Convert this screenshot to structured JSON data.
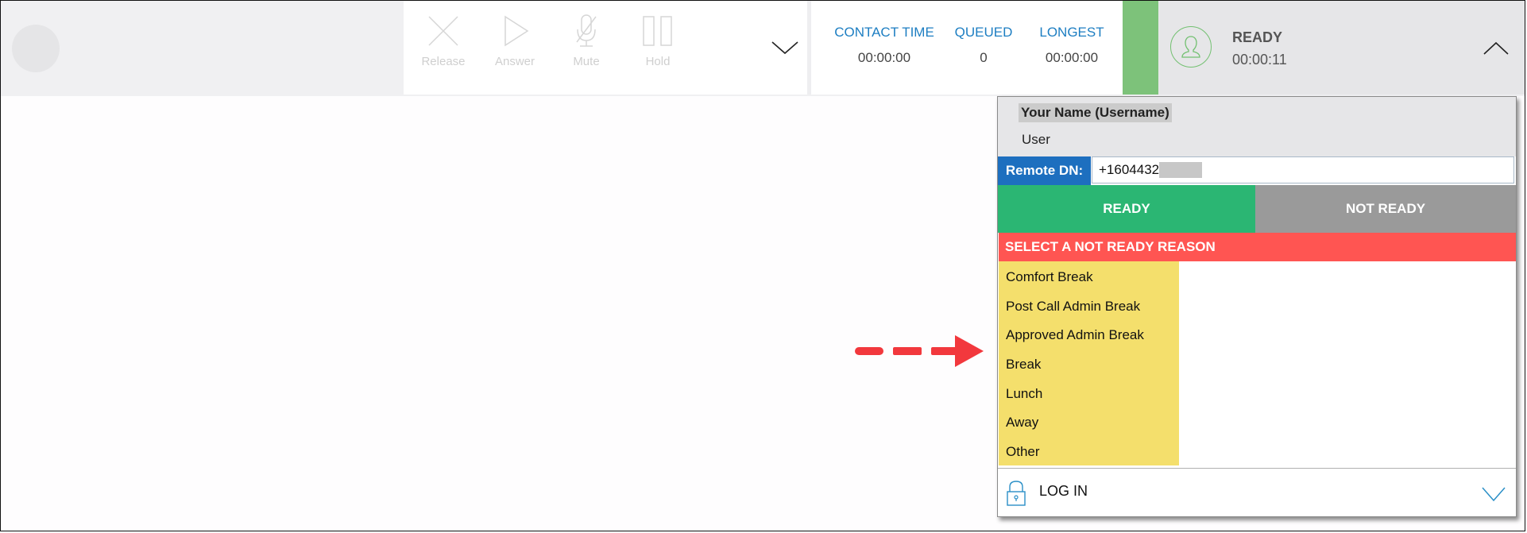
{
  "toolbar": {
    "buttons": [
      {
        "label": "Release",
        "icon": "close-icon",
        "enabled": false
      },
      {
        "label": "Answer",
        "icon": "play-icon",
        "enabled": false
      },
      {
        "label": "Mute",
        "icon": "mic-muted-icon",
        "enabled": false
      },
      {
        "label": "Hold",
        "icon": "pause-icon",
        "enabled": false
      }
    ],
    "more_icon": "chevron-down-icon"
  },
  "stats": {
    "contact_time": {
      "label": "CONTACT TIME",
      "value": "00:00:00"
    },
    "queued": {
      "label": "QUEUED",
      "value": "0"
    },
    "longest": {
      "label": "LONGEST",
      "value": "00:00:00"
    }
  },
  "agent_status": {
    "state": "READY",
    "duration": "00:00:11",
    "state_color": "#7dc27a",
    "collapse_icon": "chevron-up-icon"
  },
  "panel": {
    "user_name": "Your Name (Username)",
    "user_role": "User",
    "remote_dn_label": "Remote DN:",
    "remote_dn_value": "+1604432",
    "ready_label": "READY",
    "not_ready_label": "NOT READY",
    "reason_header": "SELECT A NOT READY REASON",
    "reasons": [
      "Comfort Break",
      "Post Call Admin Break",
      "Approved Admin Break",
      "Break",
      "Lunch",
      "Away",
      "Other"
    ],
    "login_label": "LOG IN"
  },
  "colors": {
    "ready": "#2bb673",
    "not_ready": "#9a9a9a",
    "reason_header": "#ff5552",
    "reason_list": "#f4df6c",
    "accent_blue": "#1d6fbf",
    "annotation_arrow": "#f2383d"
  }
}
